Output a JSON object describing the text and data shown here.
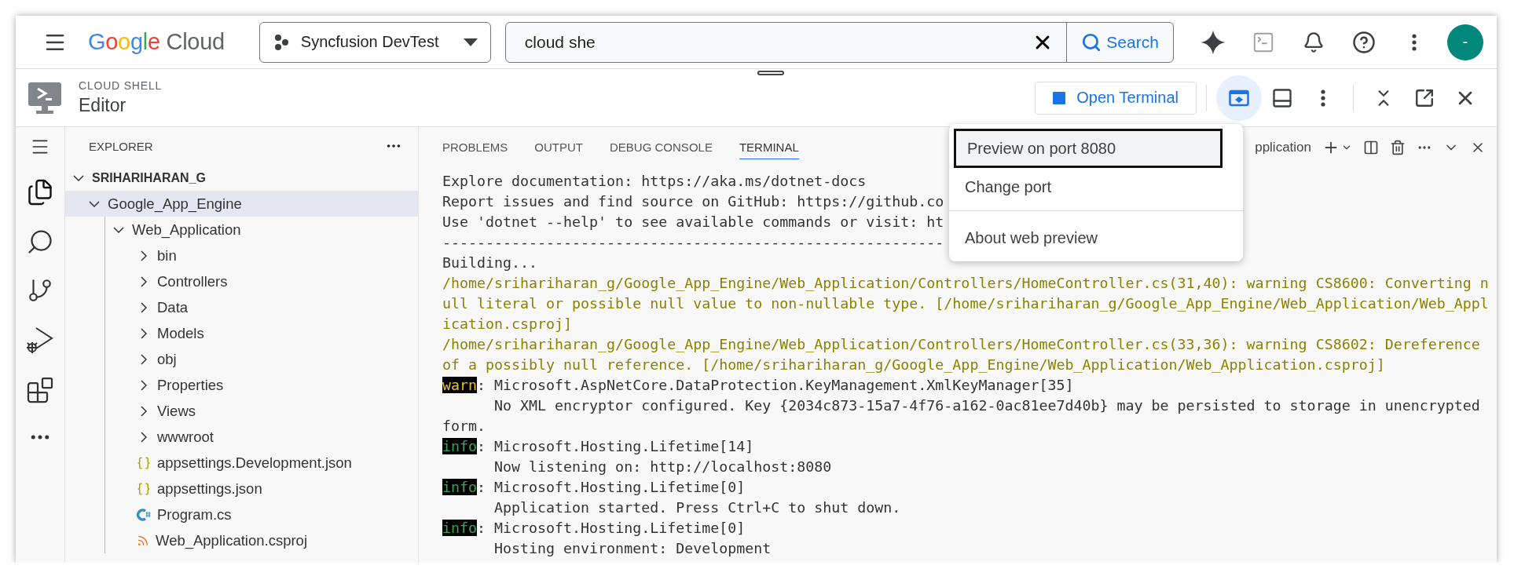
{
  "top_bar": {
    "logo": {
      "brand": "Google",
      "product": "Cloud"
    },
    "project": "Syncfusion DevTest",
    "search": {
      "value": "cloud she",
      "button": "Search"
    },
    "avatar": "-"
  },
  "cloud_shell": {
    "section": "CLOUD SHELL",
    "title": "Editor",
    "open_terminal": "Open Terminal",
    "web_preview_active": true
  },
  "web_preview_menu": [
    {
      "label": "Preview on port 8080",
      "focused": true
    },
    {
      "label": "Change port",
      "focused": false
    },
    {
      "label": "About web preview",
      "focused": false,
      "divider_before": true
    }
  ],
  "explorer": {
    "title": "EXPLORER",
    "root": "SRIHARIHARAN_G",
    "tree": [
      {
        "label": "Google_App_Engine",
        "kind": "folder",
        "expanded": true,
        "selected": true,
        "children": [
          {
            "label": "Web_Application",
            "kind": "folder",
            "expanded": true,
            "selected": false,
            "children": [
              {
                "label": "bin",
                "kind": "folder",
                "expanded": false,
                "selected": false
              },
              {
                "label": "Controllers",
                "kind": "folder",
                "expanded": false,
                "selected": false
              },
              {
                "label": "Data",
                "kind": "folder",
                "expanded": false,
                "selected": false
              },
              {
                "label": "Models",
                "kind": "folder",
                "expanded": false,
                "selected": false
              },
              {
                "label": "obj",
                "kind": "folder",
                "expanded": false,
                "selected": false
              },
              {
                "label": "Properties",
                "kind": "folder",
                "expanded": false,
                "selected": false
              },
              {
                "label": "Views",
                "kind": "folder",
                "expanded": false,
                "selected": false
              },
              {
                "label": "wwwroot",
                "kind": "folder",
                "expanded": false,
                "selected": false
              },
              {
                "label": "appsettings.Development.json",
                "kind": "json",
                "selected": false
              },
              {
                "label": "appsettings.json",
                "kind": "json",
                "selected": false
              },
              {
                "label": "Program.cs",
                "kind": "csharp",
                "selected": false
              },
              {
                "label": "Web_Application.csproj",
                "kind": "project",
                "selected": false
              }
            ]
          }
        ]
      }
    ]
  },
  "panel": {
    "tabs": [
      {
        "label": "PROBLEMS",
        "selected": false
      },
      {
        "label": "OUTPUT",
        "selected": false
      },
      {
        "label": "DEBUG CONSOLE",
        "selected": false
      },
      {
        "label": "TERMINAL",
        "selected": true
      }
    ],
    "terminal_name": "pplication",
    "lines": [
      {
        "kind": "plain",
        "text": "Explore documentation: https://aka.ms/dotnet-docs"
      },
      {
        "kind": "plain",
        "text": "Report issues and find source on GitHub: https://github.co"
      },
      {
        "kind": "plain",
        "text": "Use 'dotnet --help' to see available commands or visit: ht"
      },
      {
        "kind": "plain",
        "text": "----------------------------------------------------------"
      },
      {
        "kind": "plain",
        "text": "Building..."
      },
      {
        "kind": "warning",
        "text": "/home/srihariharan_g/Google_App_Engine/Web_Application/Controllers/HomeController.cs(31,40): warning CS8600: Converting n"
      },
      {
        "kind": "warning",
        "text": "ull literal or possible null value to non-nullable type. [/home/srihariharan_g/Google_App_Engine/Web_Application/Web_Appl"
      },
      {
        "kind": "warning",
        "text": "ication.csproj]"
      },
      {
        "kind": "warning",
        "text": "/home/srihariharan_g/Google_App_Engine/Web_Application/Controllers/HomeController.cs(33,36): warning CS8602: Dereference"
      },
      {
        "kind": "warning",
        "text": "of a possibly null reference. [/home/srihariharan_g/Google_App_Engine/Web_Application/Web_Application.csproj]"
      },
      {
        "kind": "warn",
        "tag": "warn",
        "text": ": Microsoft.AspNetCore.DataProtection.KeyManagement.XmlKeyManager[35]"
      },
      {
        "kind": "plain",
        "text": "      No XML encryptor configured. Key {2034c873-15a7-4f76-a162-0ac81ee7d40b} may be persisted to storage in unencrypted"
      },
      {
        "kind": "plain",
        "text": "form."
      },
      {
        "kind": "info",
        "tag": "info",
        "text": ": Microsoft.Hosting.Lifetime[14]"
      },
      {
        "kind": "plain",
        "text": "      Now listening on: http://localhost:8080"
      },
      {
        "kind": "info",
        "tag": "info",
        "text": ": Microsoft.Hosting.Lifetime[0]"
      },
      {
        "kind": "plain",
        "text": "      Application started. Press Ctrl+C to shut down."
      },
      {
        "kind": "info",
        "tag": "info",
        "text": ": Microsoft.Hosting.Lifetime[0]"
      },
      {
        "kind": "plain",
        "text": "      Hosting environment: Development"
      }
    ]
  }
}
